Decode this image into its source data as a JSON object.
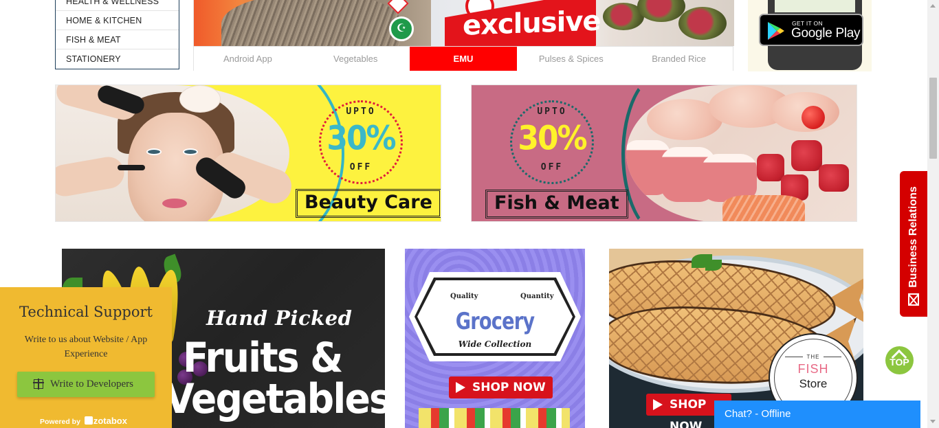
{
  "categories": [
    "HEALTH & WELLNESS",
    "HOME & KITCHEN",
    "FISH & MEAT",
    "STATIONERY"
  ],
  "slider": {
    "slide1_badge": "HALAL",
    "slide2_headline": "exclusive",
    "tabs": [
      "Android App",
      "Vegetables",
      "EMU",
      "Pulses & Spices",
      "Branded Rice"
    ],
    "active_tab": "EMU"
  },
  "app_promo": {
    "small": "GET IT ON",
    "big": "Google Play"
  },
  "promos": [
    {
      "upto": "UPTO",
      "percent": "30%",
      "off": "OFF",
      "label": "Beauty Care",
      "percent_color": "#3bb8c8"
    },
    {
      "upto": "UPTO",
      "percent": "30%",
      "off": "OFF",
      "label": "Fish & Meat",
      "percent_color": "#fff22a"
    }
  ],
  "banners": {
    "fruits": {
      "tagline": "Hand Picked",
      "line1": "Fruits &",
      "line2": "Vegetables"
    },
    "grocery": {
      "quality": "Quality",
      "quantity": "Quantity",
      "title": "Grocery",
      "subtitle": "Wide Collection",
      "cta": "SHOP NOW"
    },
    "fish_store": {
      "the": "THE",
      "fish": "FISH",
      "store": "Store",
      "cta": "SHOP NOW"
    }
  },
  "support": {
    "title": "Technical Support",
    "description": "Write to us about Website / App Experience",
    "button": "Write to Developers",
    "powered_by": "Powered by",
    "brand": "zotabox"
  },
  "side": {
    "business_relations": "Business Relations",
    "top": "TOP",
    "chat": "Chat? - Offline"
  },
  "colors": {
    "accent_red": "#ff0000",
    "support_bg": "#f0ba30",
    "green": "#8cc63f",
    "chat_blue": "#1f8ffd"
  }
}
